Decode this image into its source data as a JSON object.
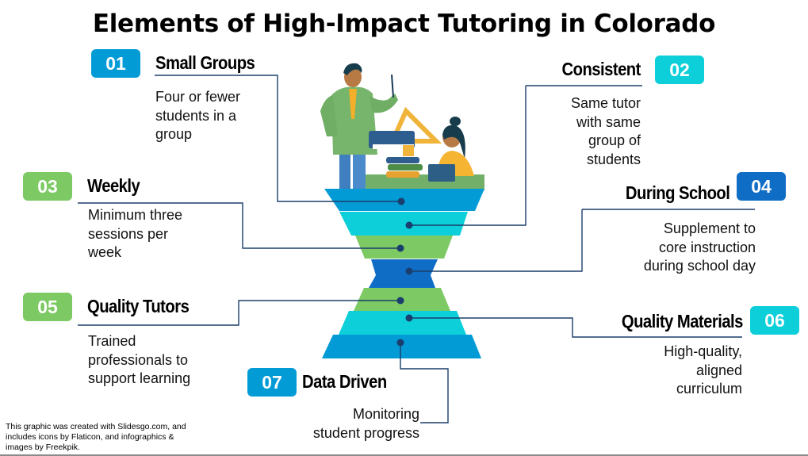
{
  "title": "Elements of High-Impact Tutoring in Colorado",
  "colors": {
    "blue": "#039BD6",
    "cyan": "#0CCFD9",
    "green": "#7DC964",
    "royal": "#106DC6",
    "connector": "#1B3F6B",
    "dot": "#1A3E6E"
  },
  "elements": [
    {
      "number": "01",
      "title": "Small Groups",
      "description": "Four or fewer students in a group",
      "lines": [
        "Four or fewer",
        "students in a",
        "group"
      ],
      "color": "blue"
    },
    {
      "number": "02",
      "title": "Consistent",
      "description": "Same tutor with same group of students",
      "lines": [
        "Same tutor",
        "with same",
        "group of",
        "students"
      ],
      "color": "cyan"
    },
    {
      "number": "03",
      "title": "Weekly",
      "description": "Minimum three sessions per week",
      "lines": [
        "Minimum three",
        "sessions per",
        "week"
      ],
      "color": "green"
    },
    {
      "number": "04",
      "title": "During School",
      "description": "Supplement to core instruction during school day",
      "lines": [
        "Supplement to",
        "core instruction",
        "during school day"
      ],
      "color": "royal"
    },
    {
      "number": "05",
      "title": "Quality Tutors",
      "description": "Trained professionals to support learning",
      "lines": [
        "Trained",
        "professionals to",
        "support learning"
      ],
      "color": "green"
    },
    {
      "number": "06",
      "title": "Quality Materials",
      "description": "High-quality, aligned curriculum",
      "lines": [
        "High-quality,",
        "aligned",
        "curriculum"
      ],
      "color": "cyan"
    },
    {
      "number": "07",
      "title": "Data Driven",
      "description": "Monitoring student progress",
      "lines": [
        "Monitoring",
        "student progress"
      ],
      "color": "blue"
    }
  ],
  "illustration": {
    "subject": "teacher-and-student-at-desk",
    "description": "Teacher in green jacket holding pointer, student with laptop at desk, stack of books, pencil cup and set square"
  },
  "credit": {
    "lines": [
      "This graphic was created with Slidesgo.com, and",
      "includes icons by Flaticon, and infographics &",
      "images by Freekpik."
    ]
  }
}
